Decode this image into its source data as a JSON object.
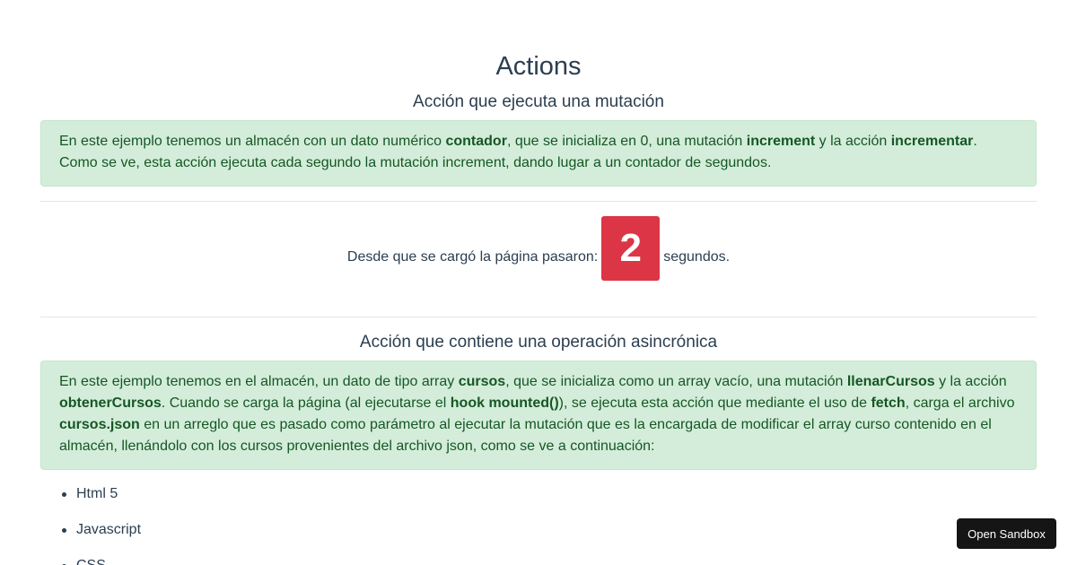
{
  "page": {
    "title": "Actions"
  },
  "section1": {
    "title": "Acción que ejecuta una mutación",
    "alert": {
      "t1": "En este ejemplo tenemos un almacén con un dato numérico ",
      "b1": "contador",
      "t2": ", que se inicializa en 0, una mutación ",
      "b2": "increment",
      "t3": " y la acción ",
      "b3": "incrementar",
      "t4": ". Como se ve, esta acción ejecuta cada segundo la mutación increment, dando lugar a un contador de segundos."
    },
    "counter": {
      "prefix": "Desde que se cargó la página pasaron:",
      "value": "2",
      "suffix": "segundos."
    }
  },
  "section2": {
    "title": "Acción que contiene una operación asincrónica",
    "alert": {
      "t1": "En este ejemplo tenemos en el almacén, un dato de tipo array ",
      "b1": "cursos",
      "t2": ", que se inicializa como un array vacío, una mutación ",
      "b2": "llenarCursos",
      "t3": " y la acción ",
      "b3": "obtenerCursos",
      "t4": ". Cuando se carga la página (al ejecutarse el ",
      "b4": "hook mounted()",
      "t5": "), se ejecuta esta acción que mediante el uso de ",
      "b5": "fetch",
      "t6": ", carga el archivo ",
      "b6": "cursos.json",
      "t7": " en un arreglo que es pasado como parámetro al ejecutar la mutación que es la encargada de modificar el array curso contenido en el almacén, llenándolo con los cursos provenientes del archivo json, como se ve a continuación:"
    },
    "courses": [
      "Html 5",
      "Javascript",
      "CSS"
    ]
  },
  "sandbox": {
    "label": "Open Sandbox"
  }
}
